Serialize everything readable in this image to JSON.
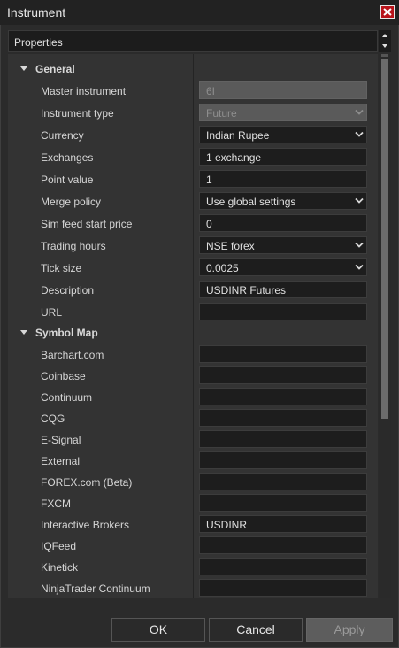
{
  "window": {
    "title": "Instrument"
  },
  "header": {
    "label": "Properties"
  },
  "categories": {
    "general": "General",
    "symbol_map": "Symbol Map"
  },
  "general_rows": [
    {
      "label": "Master instrument",
      "value": "6I",
      "disabled": true,
      "dropdown": false
    },
    {
      "label": "Instrument type",
      "value": "Future",
      "disabled": true,
      "dropdown": true
    },
    {
      "label": "Currency",
      "value": "Indian Rupee",
      "dropdown": true
    },
    {
      "label": "Exchanges",
      "value": "1 exchange",
      "dropdown": false
    },
    {
      "label": "Point value",
      "value": "1",
      "dropdown": false
    },
    {
      "label": "Merge policy",
      "value": "Use global settings",
      "dropdown": true
    },
    {
      "label": "Sim feed start price",
      "value": "0",
      "dropdown": false
    },
    {
      "label": "Trading hours",
      "value": "NSE forex",
      "dropdown": true
    },
    {
      "label": "Tick size",
      "value": "0.0025",
      "dropdown": true
    },
    {
      "label": "Description",
      "value": "USDINR Futures",
      "dropdown": false
    },
    {
      "label": "URL",
      "value": "",
      "dropdown": false
    }
  ],
  "symbol_rows": [
    {
      "label": "Barchart.com",
      "value": ""
    },
    {
      "label": "Coinbase",
      "value": ""
    },
    {
      "label": "Continuum",
      "value": ""
    },
    {
      "label": "CQG",
      "value": ""
    },
    {
      "label": "E-Signal",
      "value": ""
    },
    {
      "label": "External",
      "value": ""
    },
    {
      "label": "FOREX.com (Beta)",
      "value": ""
    },
    {
      "label": "FXCM",
      "value": ""
    },
    {
      "label": "Interactive Brokers",
      "value": "USDINR"
    },
    {
      "label": "IQFeed",
      "value": ""
    },
    {
      "label": "Kinetick",
      "value": ""
    },
    {
      "label": "NinjaTrader Continuum",
      "value": ""
    }
  ],
  "buttons": {
    "ok": "OK",
    "cancel": "Cancel",
    "apply": "Apply"
  },
  "colors": {
    "close": "#b8141b",
    "field_bg": "#1d1d1d",
    "grid_bg": "#333333"
  }
}
